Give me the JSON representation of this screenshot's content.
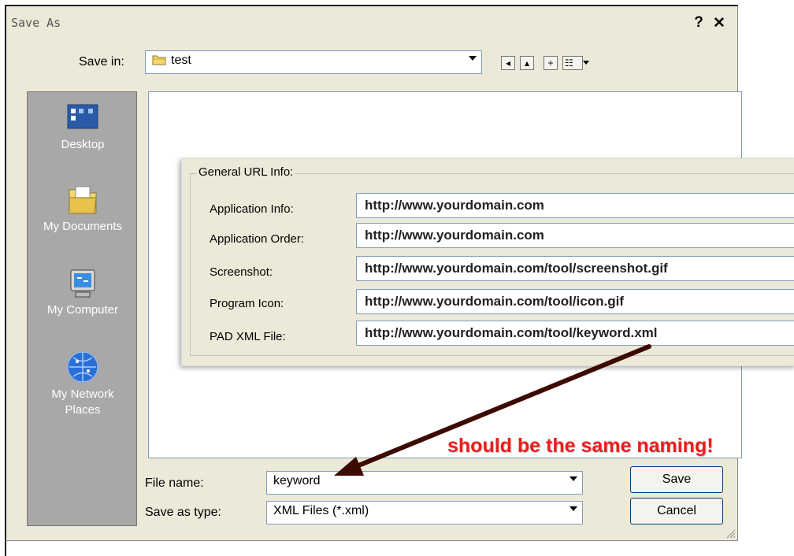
{
  "window": {
    "title": "Save As",
    "help_glyph": "?",
    "close_glyph": "✕"
  },
  "toolbar": {
    "save_in_label": "Save in:",
    "save_in_value": "test",
    "buttons": [
      {
        "name": "back-button",
        "glyph": "◂"
      },
      {
        "name": "up-folder-button",
        "glyph": "▴"
      },
      {
        "name": "new-folder-button",
        "glyph": "+"
      },
      {
        "name": "view-menu-button",
        "glyph": "☷"
      }
    ]
  },
  "places": [
    {
      "label": "Desktop",
      "icon": "desktop-icon"
    },
    {
      "label": "My Documents",
      "icon": "my-documents-icon"
    },
    {
      "label": "My Computer",
      "icon": "my-computer-icon"
    },
    {
      "label": "My Network Places",
      "icon": "network-places-icon"
    }
  ],
  "url_info": {
    "title": "General URL Info:",
    "rows": [
      {
        "label": "Application Info:",
        "value": "http://www.yourdomain.com"
      },
      {
        "label": "Application Order:",
        "value": "http://www.yourdomain.com"
      },
      {
        "label": "Screenshot:",
        "value": "http://www.yourdomain.com/tool/screenshot.gif"
      },
      {
        "label": "Program Icon:",
        "value": "http://www.yourdomain.com/tool/icon.gif"
      },
      {
        "label": "PAD XML File:",
        "value": "http://www.yourdomain.com/tool/keyword.xml"
      }
    ]
  },
  "annotation": {
    "text": "should be the same naming!",
    "arrow_color": "#3d0a00",
    "text_color": "#ee1c1c"
  },
  "form": {
    "file_name_label": "File name:",
    "file_name_value": "keyword",
    "save_type_label": "Save as type:",
    "save_type_value": "XML Files (*.xml)"
  },
  "buttons": {
    "save": "Save",
    "cancel": "Cancel"
  }
}
